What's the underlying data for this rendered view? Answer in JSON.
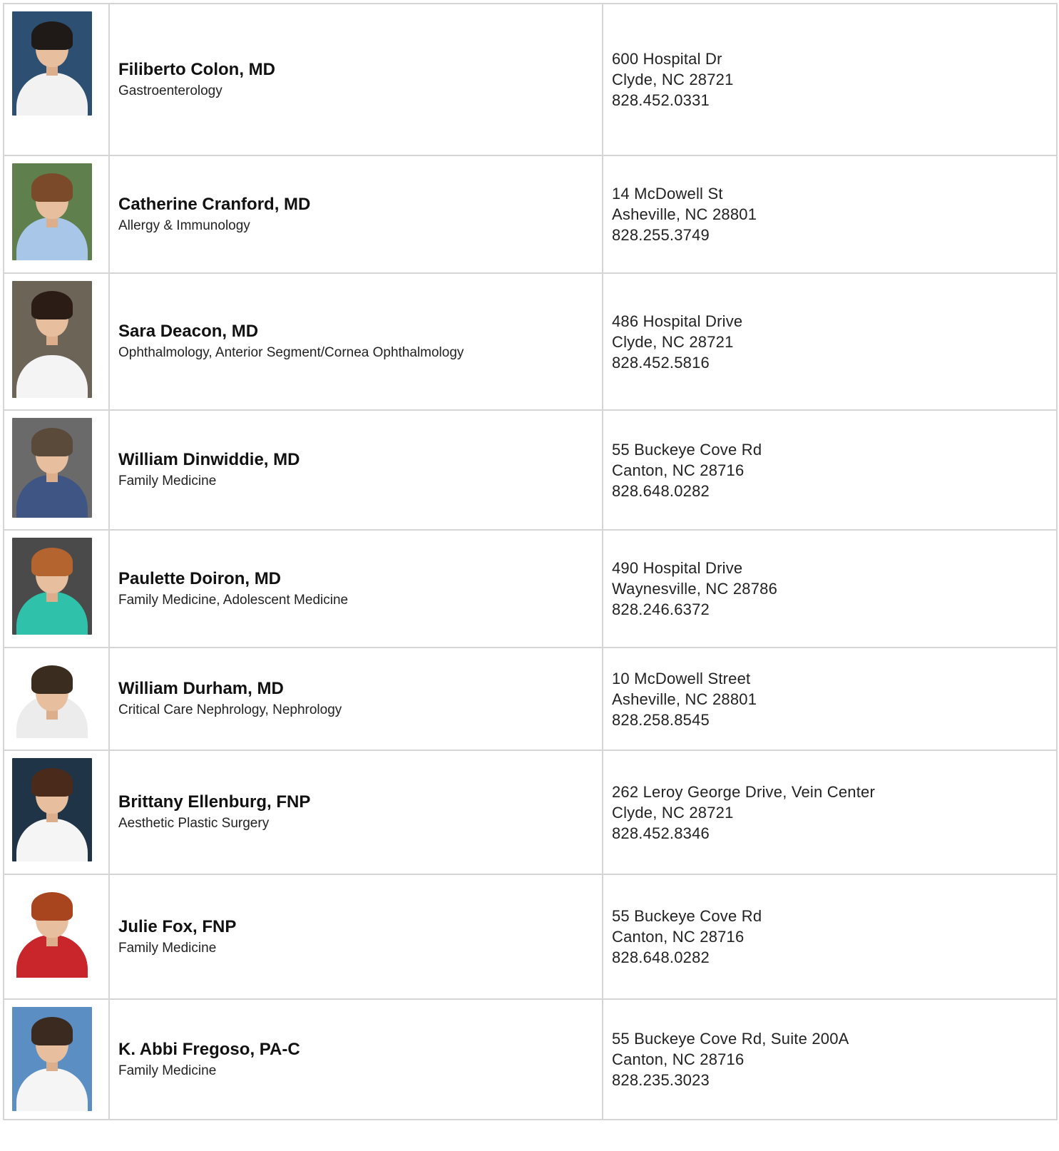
{
  "providers": [
    {
      "name": "Filiberto Colon, MD",
      "specialty": "Gastroenterology",
      "address1": "600 Hospital Dr",
      "city": "Clyde, NC 28721",
      "phone": "828.452.0331",
      "photo_bg": "#2c4f72",
      "hair": "#1f1a17",
      "clothing": "#f2f2f2"
    },
    {
      "name": "Catherine Cranford, MD",
      "specialty": "Allergy & Immunology",
      "address1": "14 McDowell St",
      "city": "Asheville, NC 28801",
      "phone": "828.255.3749",
      "photo_bg": "#5f7f4c",
      "hair": "#7a4a2a",
      "clothing": "#a8c6e8"
    },
    {
      "name": "Sara Deacon, MD",
      "specialty": "Ophthalmology, Anterior Segment/Cornea Ophthalmology",
      "address1": "486 Hospital Drive",
      "city": "Clyde, NC 28721",
      "phone": "828.452.5816",
      "photo_bg": "#6d6458",
      "hair": "#2b1d16",
      "clothing": "#f4f4f4"
    },
    {
      "name": "William Dinwiddie, MD",
      "specialty": "Family Medicine",
      "address1": "55 Buckeye Cove Rd",
      "city": "Canton, NC 28716",
      "phone": "828.648.0282",
      "photo_bg": "#6a6a6a",
      "hair": "#5a4a3a",
      "clothing": "#3f5684"
    },
    {
      "name": "Paulette Doiron, MD",
      "specialty": "Family Medicine, Adolescent Medicine",
      "address1": "490 Hospital Drive",
      "city": "Waynesville, NC 28786",
      "phone": "828.246.6372",
      "photo_bg": "#4a4a4a",
      "hair": "#b4642f",
      "clothing": "#2fc1aa"
    },
    {
      "name": "William Durham, MD",
      "specialty": "Critical Care Nephrology, Nephrology",
      "address1": "10 McDowell Street",
      "city": "Asheville, NC 28801",
      "phone": "828.258.8545",
      "photo_bg": "#ffffff",
      "hair": "#3b2c20",
      "clothing": "#ececec"
    },
    {
      "name": "Brittany Ellenburg, FNP",
      "specialty": "Aesthetic Plastic Surgery",
      "address1": "262 Leroy George Drive, Vein Center",
      "city": "Clyde, NC 28721",
      "phone": "828.452.8346",
      "photo_bg": "#203448",
      "hair": "#4a2a1a",
      "clothing": "#f5f5f5"
    },
    {
      "name": "Julie Fox, FNP",
      "specialty": "Family Medicine",
      "address1": "55 Buckeye Cove Rd",
      "city": "Canton, NC 28716",
      "phone": "828.648.0282",
      "photo_bg": "#ffffff",
      "hair": "#a8451f",
      "clothing": "#c8262a"
    },
    {
      "name": "K. Abbi Fregoso, PA-C",
      "specialty": "Family Medicine",
      "address1": "55 Buckeye Cove Rd, Suite 200A",
      "city": "Canton, NC 28716",
      "phone": "828.235.3023",
      "photo_bg": "#5b8ec2",
      "hair": "#3a2a20",
      "clothing": "#f5f5f5"
    }
  ]
}
